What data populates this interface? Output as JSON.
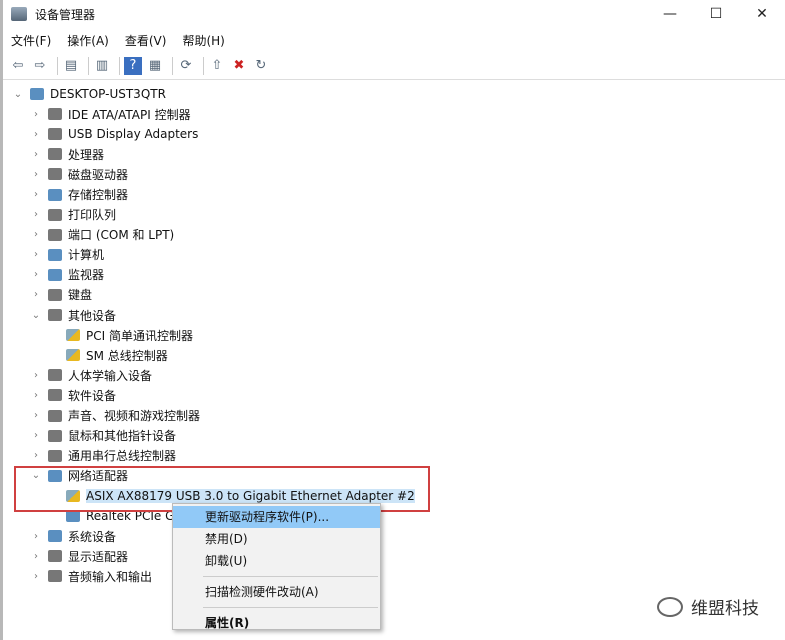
{
  "window": {
    "title": "设备管理器",
    "minimize": "—",
    "maximize": "☐",
    "close": "✕"
  },
  "menu": [
    "文件(F)",
    "操作(A)",
    "查看(V)",
    "帮助(H)"
  ],
  "toolbar": [
    {
      "icon": "back-icon",
      "g": "⇦"
    },
    {
      "icon": "forward-icon",
      "g": "⇨"
    },
    {
      "icon": "sep"
    },
    {
      "icon": "show-hide-console-tree-icon",
      "g": "▤"
    },
    {
      "icon": "sep"
    },
    {
      "icon": "properties-icon",
      "g": "▥"
    },
    {
      "icon": "sep"
    },
    {
      "icon": "help-icon",
      "g": "?"
    },
    {
      "icon": "action-pane-icon",
      "g": "▦"
    },
    {
      "icon": "sep"
    },
    {
      "icon": "scan-hardware-icon",
      "g": "⟳"
    },
    {
      "icon": "sep"
    },
    {
      "icon": "update-driver-icon",
      "g": "⇧"
    },
    {
      "icon": "uninstall-device-icon",
      "g": "✖"
    },
    {
      "icon": "enable-device-icon",
      "g": "↻"
    }
  ],
  "tree": [
    {
      "label": "DESKTOP-UST3QTR",
      "level": 0,
      "exp": "open",
      "icon": "computer-icon"
    },
    {
      "label": "IDE ATA/ATAPI 控制器",
      "level": 1,
      "exp": "closed",
      "icon": "ide-controller-icon"
    },
    {
      "label": "USB Display Adapters",
      "level": 1,
      "exp": "closed",
      "icon": "usb-icon"
    },
    {
      "label": "处理器",
      "level": 1,
      "exp": "closed",
      "icon": "processor-icon"
    },
    {
      "label": "磁盘驱动器",
      "level": 1,
      "exp": "closed",
      "icon": "disk-drive-icon"
    },
    {
      "label": "存储控制器",
      "level": 1,
      "exp": "closed",
      "icon": "storage-controller-icon"
    },
    {
      "label": "打印队列",
      "level": 1,
      "exp": "closed",
      "icon": "printer-icon"
    },
    {
      "label": "端口 (COM 和 LPT)",
      "level": 1,
      "exp": "closed",
      "icon": "port-icon"
    },
    {
      "label": "计算机",
      "level": 1,
      "exp": "closed",
      "icon": "computer-icon"
    },
    {
      "label": "监视器",
      "level": 1,
      "exp": "closed",
      "icon": "monitor-icon"
    },
    {
      "label": "键盘",
      "level": 1,
      "exp": "closed",
      "icon": "keyboard-icon"
    },
    {
      "label": "其他设备",
      "level": 1,
      "exp": "open",
      "icon": "other-devices-icon"
    },
    {
      "label": "PCI 简单通讯控制器",
      "level": 2,
      "exp": "none",
      "icon": "warning-device-icon"
    },
    {
      "label": "SM 总线控制器",
      "level": 2,
      "exp": "none",
      "icon": "warning-device-icon"
    },
    {
      "label": "人体学输入设备",
      "level": 1,
      "exp": "closed",
      "icon": "hid-icon"
    },
    {
      "label": "软件设备",
      "level": 1,
      "exp": "closed",
      "icon": "software-device-icon"
    },
    {
      "label": "声音、视频和游戏控制器",
      "level": 1,
      "exp": "closed",
      "icon": "sound-icon"
    },
    {
      "label": "鼠标和其他指针设备",
      "level": 1,
      "exp": "closed",
      "icon": "mouse-icon"
    },
    {
      "label": "通用串行总线控制器",
      "level": 1,
      "exp": "closed",
      "icon": "usb-controller-icon"
    },
    {
      "label": "网络适配器",
      "level": 1,
      "exp": "open",
      "icon": "network-adapter-icon"
    },
    {
      "label": "ASIX AX88179 USB 3.0 to Gigabit Ethernet Adapter #2",
      "level": 2,
      "exp": "none",
      "icon": "warning-network-icon",
      "selected": true
    },
    {
      "label": "Realtek PCIe GBE Family Controller",
      "level": 2,
      "exp": "none",
      "icon": "network-adapter-icon"
    },
    {
      "label": "系统设备",
      "level": 1,
      "exp": "closed",
      "icon": "system-devices-icon"
    },
    {
      "label": "显示适配器",
      "level": 1,
      "exp": "closed",
      "icon": "display-adapter-icon"
    },
    {
      "label": "音频输入和输出",
      "level": 1,
      "exp": "closed",
      "icon": "audio-icon"
    }
  ],
  "context_menu": {
    "update": "更新驱动程序软件(P)...",
    "disable": "禁用(D)",
    "uninstall": "卸载(U)",
    "scan": "扫描检测硬件改动(A)",
    "properties": "属性(R)"
  },
  "watermark": "维盟科技"
}
